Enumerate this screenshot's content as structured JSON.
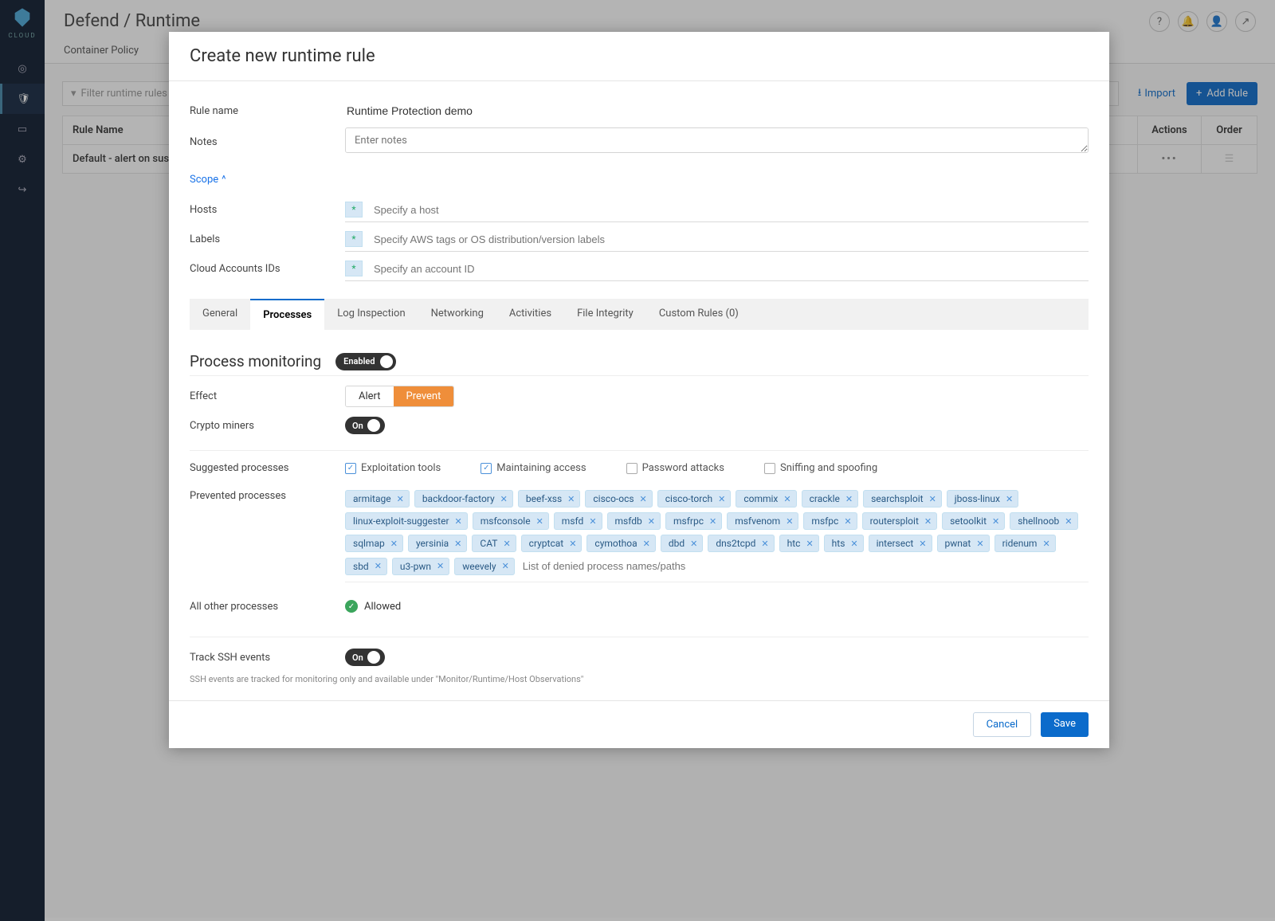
{
  "brand": "CLOUD",
  "breadcrumb": "Defend / Runtime",
  "subtab": "Container Policy",
  "filter_placeholder": "Filter runtime rules",
  "toolbar": {
    "import": "Import",
    "add_rule": "Add Rule"
  },
  "table": {
    "columns": {
      "name": "Rule Name",
      "actions": "Actions",
      "order": "Order"
    },
    "rows": [
      {
        "name": "Default - alert on suspicious runtime behavior"
      }
    ]
  },
  "modal": {
    "title": "Create new runtime rule",
    "labels": {
      "rule_name": "Rule name",
      "notes": "Notes",
      "scope": "Scope",
      "hosts": "Hosts",
      "labels": "Labels",
      "cloud": "Cloud Accounts IDs"
    },
    "rule_name_value": "Runtime Protection demo",
    "notes_placeholder": "Enter notes",
    "placeholders": {
      "hosts": "Specify a host",
      "labels": "Specify AWS tags or OS distribution/version labels",
      "cloud": "Specify an account ID"
    },
    "wildcard": "*",
    "tabs": [
      "General",
      "Processes",
      "Log Inspection",
      "Networking",
      "Activities",
      "File Integrity",
      "Custom Rules (0)"
    ],
    "active_tab": 1,
    "section": {
      "title": "Process monitoring",
      "enabled_label": "Enabled",
      "effect_label": "Effect",
      "effect_options": [
        "Alert",
        "Prevent"
      ],
      "effect_active": 1,
      "crypto_label": "Crypto miners",
      "crypto_value": "On",
      "suggested_label": "Suggested processes",
      "suggested": [
        {
          "label": "Exploitation tools",
          "checked": true
        },
        {
          "label": "Maintaining access",
          "checked": true
        },
        {
          "label": "Password attacks",
          "checked": false
        },
        {
          "label": "Sniffing and spoofing",
          "checked": false
        }
      ],
      "prevented_label": "Prevented processes",
      "chips": [
        "armitage",
        "backdoor-factory",
        "beef-xss",
        "cisco-ocs",
        "cisco-torch",
        "commix",
        "crackle",
        "searchsploit",
        "jboss-linux",
        "linux-exploit-suggester",
        "msfconsole",
        "msfd",
        "msfdb",
        "msfrpc",
        "msfvenom",
        "msfpc",
        "routersploit",
        "setoolkit",
        "shellnoob",
        "sqlmap",
        "yersinia",
        "CAT",
        "cryptcat",
        "cymothoa",
        "dbd",
        "dns2tcpd",
        "htc",
        "hts",
        "intersect",
        "pwnat",
        "ridenum",
        "sbd",
        "u3-pwn",
        "weevely"
      ],
      "chip_placeholder": "List of denied process names/paths",
      "all_other_label": "All other processes",
      "all_other_value": "Allowed",
      "ssh_label": "Track SSH events",
      "ssh_value": "On",
      "ssh_hint": "SSH events are tracked for monitoring only and available under \"Monitor/Runtime/Host Observations\""
    },
    "footer": {
      "cancel": "Cancel",
      "save": "Save"
    }
  }
}
